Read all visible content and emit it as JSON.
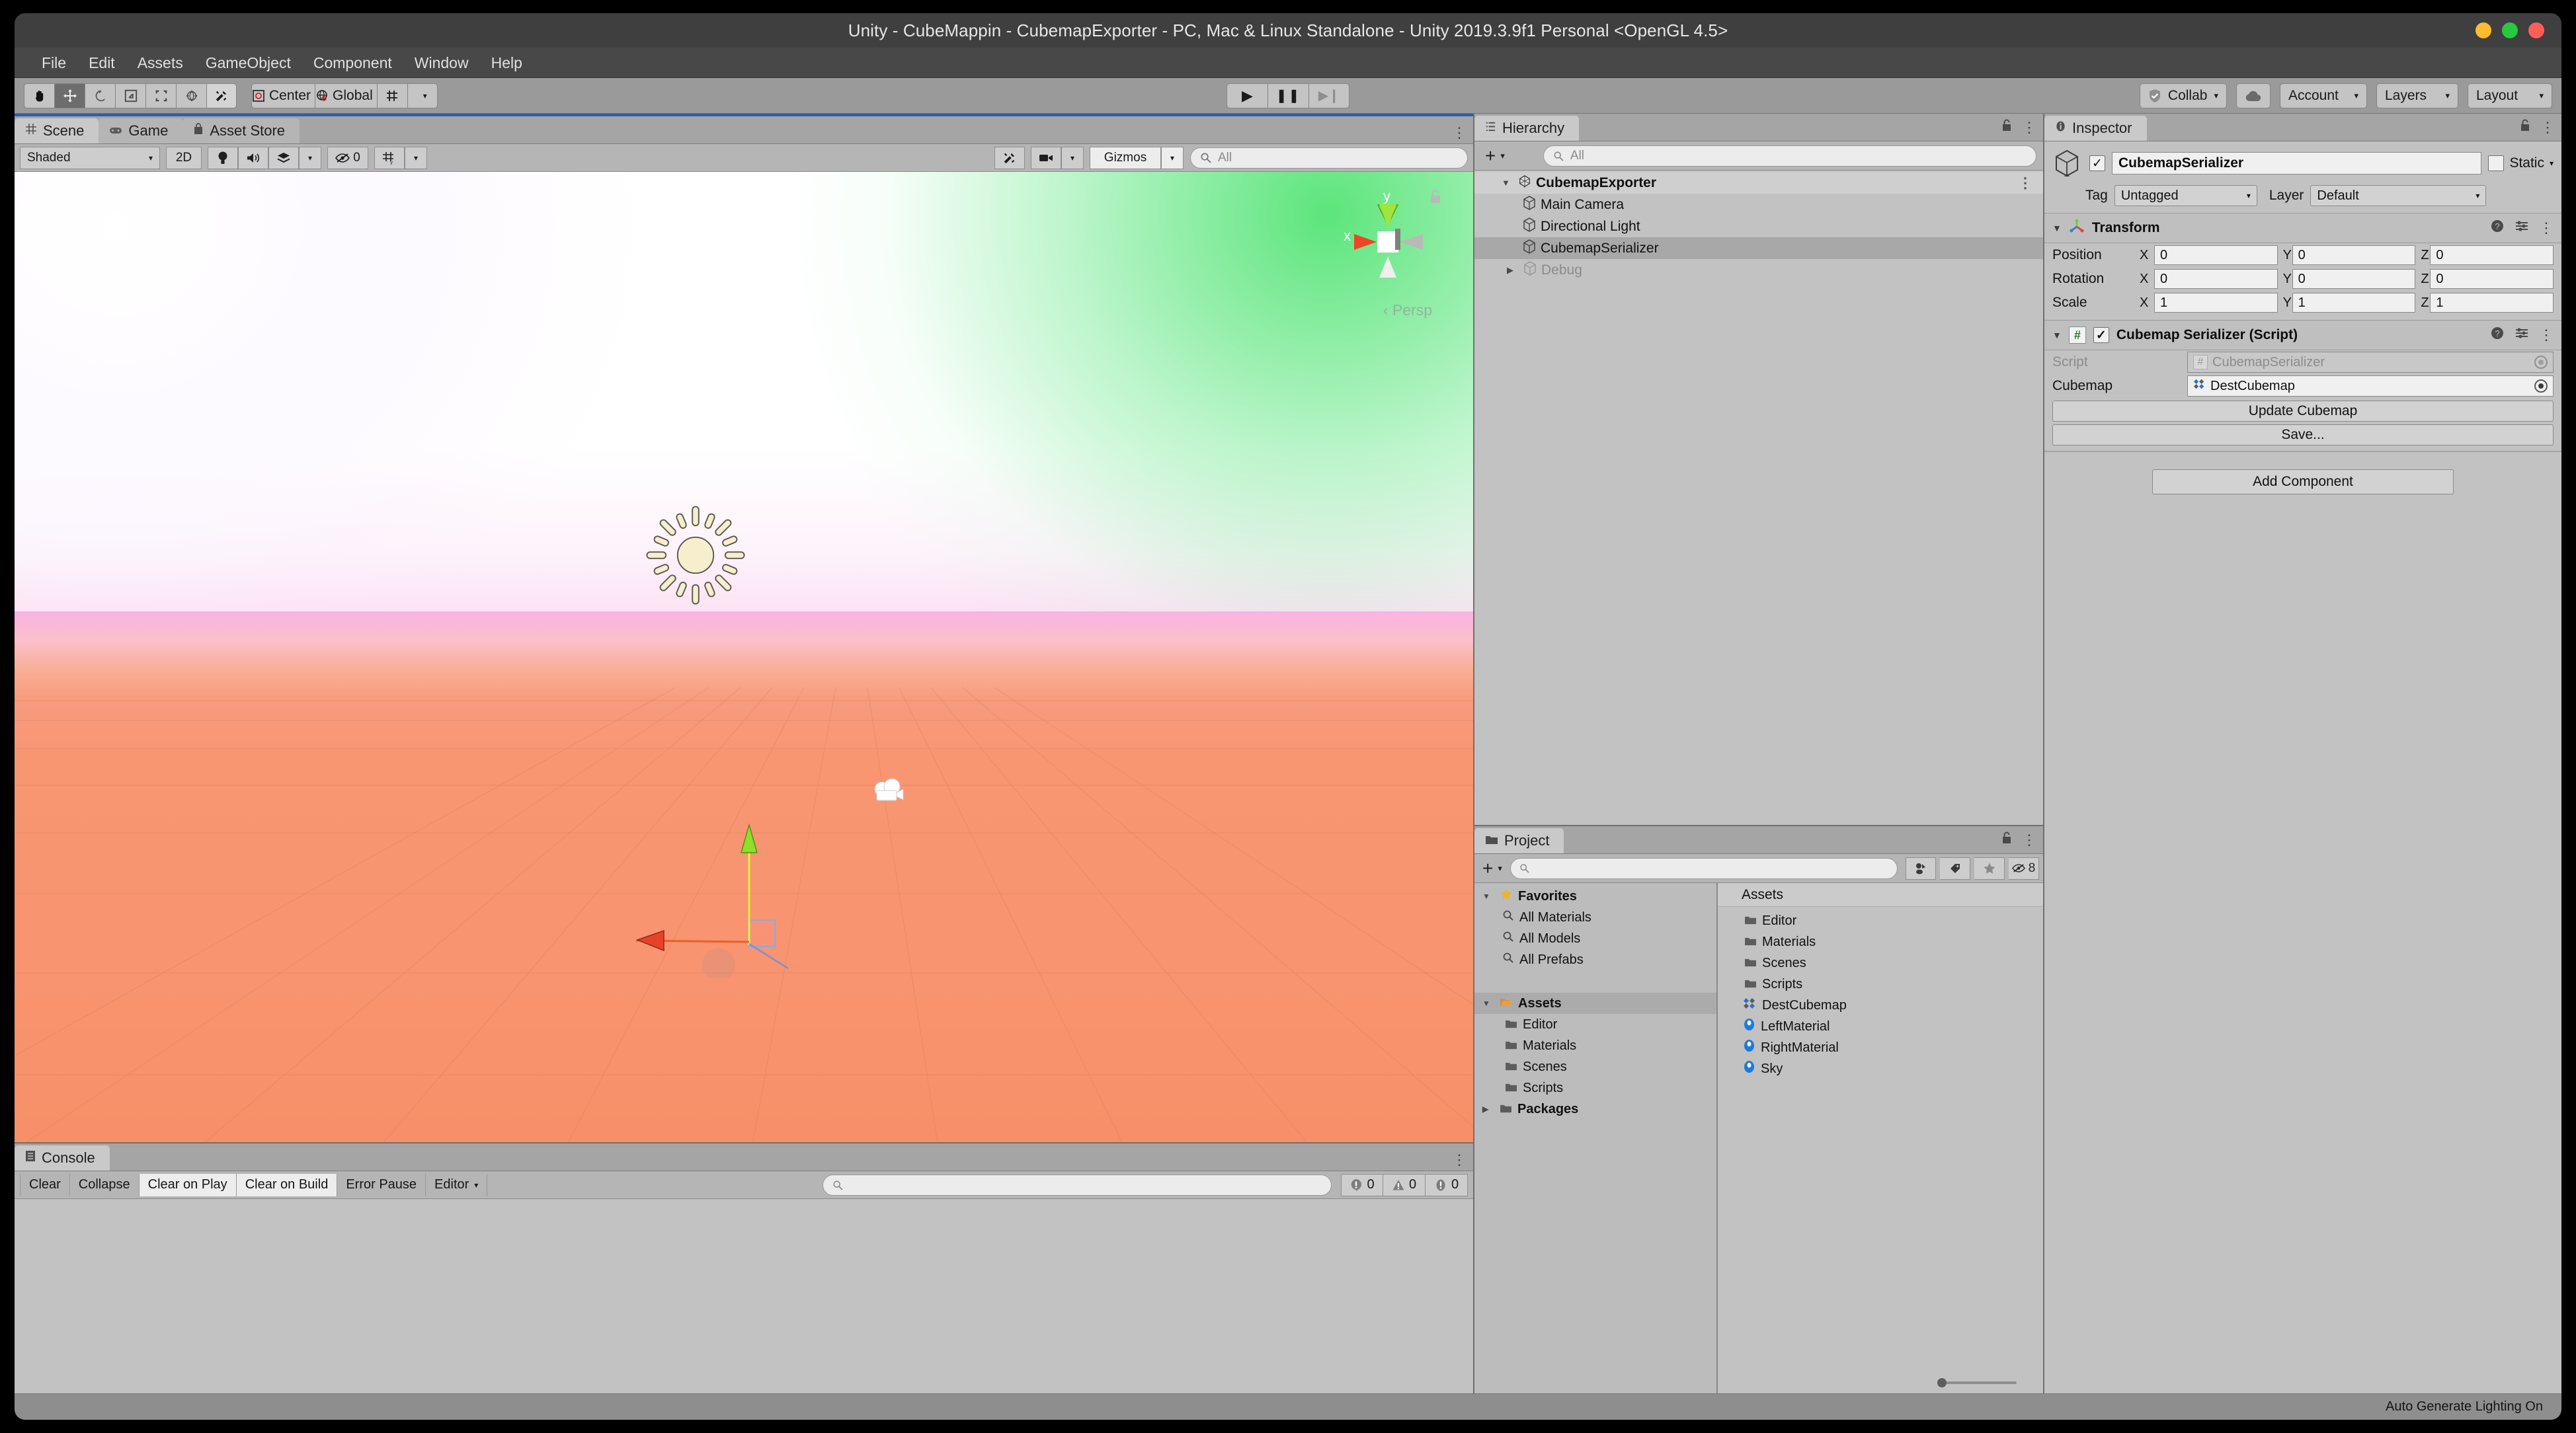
{
  "window": {
    "title": "Unity - CubeMappin - CubemapExporter - PC, Mac & Linux Standalone - Unity 2019.3.9f1 Personal <OpenGL 4.5>",
    "traffic_colors": {
      "close": "#ff5f57",
      "minimize": "#febc2e",
      "zoom": "#28c840"
    }
  },
  "menu": {
    "items": [
      "File",
      "Edit",
      "Assets",
      "GameObject",
      "Component",
      "Window",
      "Help"
    ]
  },
  "toolbar": {
    "tools": [
      {
        "name": "hand-tool",
        "glyph": "✋"
      },
      {
        "name": "move-tool",
        "glyph": "✥"
      },
      {
        "name": "rotate-tool",
        "glyph": "↺"
      },
      {
        "name": "scale-tool",
        "glyph": "⇲"
      },
      {
        "name": "rect-tool",
        "glyph": "⬚"
      },
      {
        "name": "transform-tool",
        "glyph": "✣"
      },
      {
        "name": "custom-tool",
        "glyph": "✂"
      }
    ],
    "pivot_label": "Center",
    "space_label": "Global",
    "play_label": "▶",
    "pause_label": "❚❚",
    "step_label": "▶❙",
    "collab_label": "Collab",
    "account_label": "Account",
    "layers_label": "Layers",
    "layout_label": "Layout",
    "caret": "▾"
  },
  "scene_panel": {
    "tabs": [
      {
        "label": "Scene",
        "icon": "grid-icon",
        "selected": true
      },
      {
        "label": "Game",
        "icon": "gamepad-icon",
        "selected": false
      },
      {
        "label": "Asset Store",
        "icon": "store-icon",
        "selected": false
      }
    ],
    "shading_mode": "Shaded",
    "mode_2d": "2D",
    "audio_count": "0",
    "gizmos_label": "Gizmos",
    "search_placeholder": "All",
    "view_label": "Persp",
    "axis_x": "x",
    "axis_y": "y",
    "caret": "▾"
  },
  "console_panel": {
    "tab_label": "Console",
    "buttons": [
      {
        "label": "Clear",
        "active": false
      },
      {
        "label": "Collapse",
        "active": false
      },
      {
        "label": "Clear on Play",
        "active": true
      },
      {
        "label": "Clear on Build",
        "active": true
      },
      {
        "label": "Error Pause",
        "active": false
      },
      {
        "label": "Editor",
        "active": false,
        "caret": "▾"
      }
    ],
    "search_placeholder": "",
    "counters": [
      {
        "icon": "log-icon",
        "count": "0"
      },
      {
        "icon": "warning-icon",
        "count": "0"
      },
      {
        "icon": "error-icon",
        "count": "0"
      }
    ]
  },
  "hierarchy_panel": {
    "tab_label": "Hierarchy",
    "add_label": "+",
    "search_placeholder": "All",
    "items": [
      {
        "label": "CubemapExporter",
        "depth": 0,
        "expanded": true,
        "selected": false,
        "root": true,
        "dim": false
      },
      {
        "label": "Main Camera",
        "depth": 1,
        "expanded": null,
        "selected": false,
        "root": false,
        "dim": false
      },
      {
        "label": "Directional Light",
        "depth": 1,
        "expanded": null,
        "selected": false,
        "root": false,
        "dim": false
      },
      {
        "label": "CubemapSerializer",
        "depth": 1,
        "expanded": null,
        "selected": true,
        "root": false,
        "dim": false
      },
      {
        "label": "Debug",
        "depth": 1,
        "expanded": false,
        "selected": false,
        "root": false,
        "dim": true
      }
    ]
  },
  "project_panel": {
    "tab_label": "Project",
    "add_label": "+",
    "search_placeholder": "",
    "hidden_count": "8",
    "tree": [
      {
        "label": "Favorites",
        "depth": 0,
        "expanded": true,
        "icon": "star-icon",
        "bold": true,
        "selected": false
      },
      {
        "label": "All Materials",
        "depth": 1,
        "expanded": null,
        "icon": "search-icon",
        "bold": false,
        "selected": false
      },
      {
        "label": "All Models",
        "depth": 1,
        "expanded": null,
        "icon": "search-icon",
        "bold": false,
        "selected": false
      },
      {
        "label": "All Prefabs",
        "depth": 1,
        "expanded": null,
        "icon": "search-icon",
        "bold": false,
        "selected": false
      },
      {
        "label": "",
        "depth": 0,
        "expanded": null,
        "icon": "spacer",
        "bold": false,
        "selected": false
      },
      {
        "label": "Assets",
        "depth": 0,
        "expanded": true,
        "icon": "folder-open-icon",
        "bold": true,
        "selected": true
      },
      {
        "label": "Editor",
        "depth": 1,
        "expanded": null,
        "icon": "folder-icon",
        "bold": false,
        "selected": false
      },
      {
        "label": "Materials",
        "depth": 1,
        "expanded": null,
        "icon": "folder-icon",
        "bold": false,
        "selected": false
      },
      {
        "label": "Scenes",
        "depth": 1,
        "expanded": null,
        "icon": "folder-icon",
        "bold": false,
        "selected": false
      },
      {
        "label": "Scripts",
        "depth": 1,
        "expanded": null,
        "icon": "folder-icon",
        "bold": false,
        "selected": false
      },
      {
        "label": "Packages",
        "depth": 0,
        "expanded": false,
        "icon": "folder-icon",
        "bold": true,
        "selected": false
      }
    ],
    "assets_header": "Assets",
    "assets": [
      {
        "label": "Editor",
        "icon": "folder-icon"
      },
      {
        "label": "Materials",
        "icon": "folder-icon"
      },
      {
        "label": "Scenes",
        "icon": "folder-icon"
      },
      {
        "label": "Scripts",
        "icon": "folder-icon"
      },
      {
        "label": "DestCubemap",
        "icon": "cubemap-icon"
      },
      {
        "label": "LeftMaterial",
        "icon": "material-icon"
      },
      {
        "label": "RightMaterial",
        "icon": "material-icon"
      },
      {
        "label": "Sky",
        "icon": "material-icon"
      }
    ]
  },
  "inspector_panel": {
    "tab_label": "Inspector",
    "object_name": "CubemapSerializer",
    "enabled_check": "✓",
    "static_label": "Static",
    "tag_label": "Tag",
    "tag_value": "Untagged",
    "layer_label": "Layer",
    "layer_value": "Default",
    "caret": "▾",
    "transform": {
      "title": "Transform",
      "rows": [
        {
          "label": "Position",
          "x": "0",
          "y": "0",
          "z": "0"
        },
        {
          "label": "Rotation",
          "x": "0",
          "y": "0",
          "z": "0"
        },
        {
          "label": "Scale",
          "x": "1",
          "y": "1",
          "z": "1"
        }
      ],
      "axis_labels": [
        "X",
        "Y",
        "Z"
      ]
    },
    "script_component": {
      "title": "Cubemap Serializer (Script)",
      "script_label": "Script",
      "script_value": "CubemapSerializer",
      "cubemap_label": "Cubemap",
      "cubemap_value": "DestCubemap",
      "update_button": "Update Cubemap",
      "save_button": "Save..."
    },
    "add_component_label": "Add Component"
  },
  "statusbar": {
    "text": "Auto Generate Lighting On"
  },
  "colors": {
    "accent_blue": "#2c5fa8",
    "panel_bg": "#c2c2c2",
    "toolbar_bg": "#9a9a9a",
    "chrome_dark": "#3f3f3f",
    "gizmo_x": "#e8412a",
    "gizmo_y": "#8ee028",
    "sky_green": "#40e064",
    "ground_orange": "#f8936f"
  }
}
